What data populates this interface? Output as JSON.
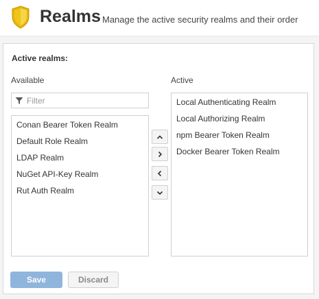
{
  "header": {
    "title": "Realms",
    "subtitle": "Manage the active security realms and their order",
    "icon": "shield-icon",
    "icon_color": "#f0c419"
  },
  "section": {
    "title": "Active realms:"
  },
  "available": {
    "label": "Available",
    "filter_placeholder": "Filter",
    "filter_value": "",
    "items": [
      "Conan Bearer Token Realm",
      "Default Role Realm",
      "LDAP Realm",
      "NuGet API-Key Realm",
      "Rut Auth Realm"
    ]
  },
  "active": {
    "label": "Active",
    "items": [
      "Local Authenticating Realm",
      "Local Authorizing Realm",
      "npm Bearer Token Realm",
      "Docker Bearer Token Realm"
    ]
  },
  "move_buttons": [
    {
      "icon": "chevron-up-icon"
    },
    {
      "icon": "chevron-right-icon"
    },
    {
      "icon": "chevron-left-icon"
    },
    {
      "icon": "chevron-down-icon"
    }
  ],
  "actions": {
    "save_label": "Save",
    "discard_label": "Discard"
  },
  "colors": {
    "primary_button": "#8fb5dc",
    "page_background": "#f4f4f4"
  }
}
